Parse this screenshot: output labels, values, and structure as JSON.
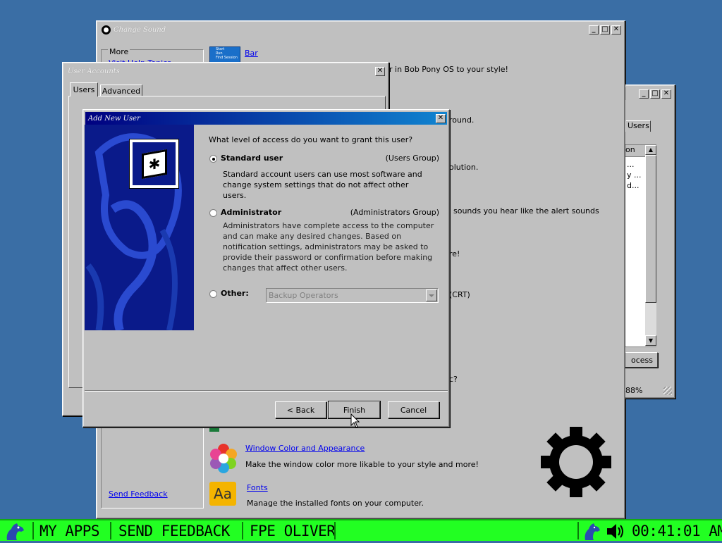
{
  "desktop": {
    "background": "#3a6ea5"
  },
  "personalize_window": {
    "title": "Change Sound",
    "sidebar": {
      "group_label": "More",
      "help_link": "Visit Help Topics",
      "feedback_link": "Send Feedback"
    },
    "items": [
      {
        "icon": "taskbar-thumbnail-icon",
        "icon_text": [
          "Start",
          "Run",
          "Find Session"
        ],
        "link": "Bar",
        "desc": "r in Bob Pony OS to your style!"
      },
      {
        "desc": "round."
      },
      {
        "desc": "olution."
      },
      {
        "desc": "sounds you hear like the alert sounds"
      },
      {
        "desc": "re!"
      },
      {
        "desc": "(CRT)"
      },
      {
        "desc": "c?"
      },
      {
        "icon": "color-wheel-icon",
        "link": "Window Color and Appearance",
        "desc": "Make the window color more likable to your style and more!"
      },
      {
        "icon": "fonts-icon",
        "icon_text": "Aa",
        "link": "Fonts",
        "desc": "Manage the installed fonts on your computer."
      }
    ]
  },
  "user_accounts_window": {
    "title": "User Accounts",
    "tabs": [
      "Users",
      "Advanced"
    ]
  },
  "right_window": {
    "tab": "Users",
    "column_header": "on",
    "rows": [
      "...",
      "y ...",
      "d..."
    ],
    "button": "ocess",
    "status": "88%"
  },
  "add_user_dialog": {
    "title": "Add New User",
    "question": "What level of access do you want to grant this user?",
    "options": [
      {
        "label": "Standard user",
        "group": "(Users Group)",
        "description": "Standard account users can use most software and change system settings that do not affect other users.",
        "selected": true
      },
      {
        "label": "Administrator",
        "group": "(Administrators Group)",
        "description": "Administrators have complete access to the computer and can make any desired changes. Based on notification settings, administrators may be asked to provide their password or confirmation before making changes that affect other users.",
        "selected": false
      },
      {
        "label": "Other:",
        "selected": false
      }
    ],
    "other_select_value": "Backup Operators",
    "buttons": {
      "back": "< Back",
      "finish": "Finish",
      "cancel": "Cancel"
    }
  },
  "taskbar": {
    "background": "#22ff22",
    "my_apps": "MY APPS",
    "send_feedback": "SEND FEEDBACK",
    "user": "FPE OLIVER",
    "clock": "00:41:01 AM"
  }
}
